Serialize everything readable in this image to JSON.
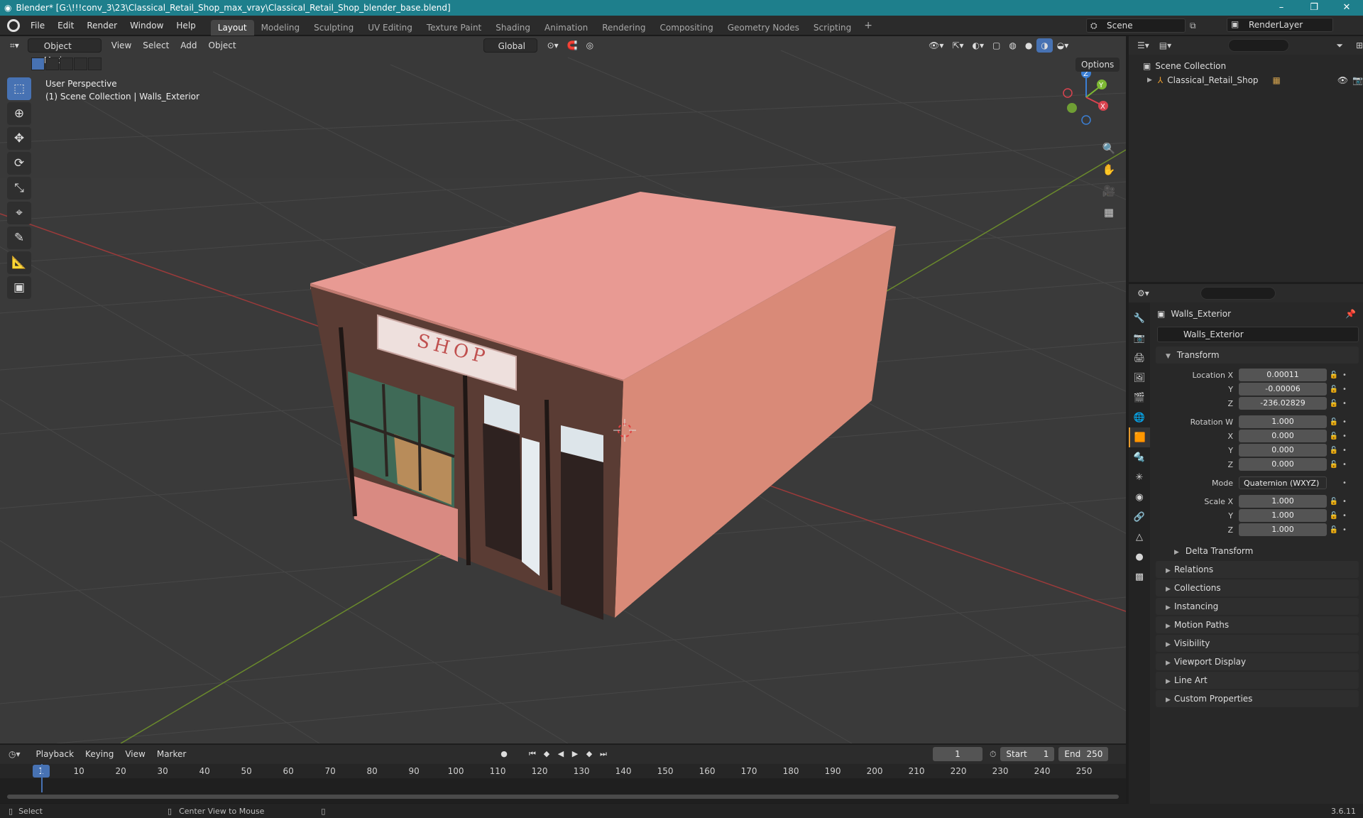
{
  "titlebar": {
    "title": "Blender* [G:\\!!!conv_3\\23\\Classical_Retail_Shop_max_vray\\Classical_Retail_Shop_blender_base.blend]",
    "minimize": "–",
    "maximize": "❐",
    "close": "✕"
  },
  "menu": [
    "File",
    "Edit",
    "Render",
    "Window",
    "Help"
  ],
  "workspaces": [
    "Layout",
    "Modeling",
    "Sculpting",
    "UV Editing",
    "Texture Paint",
    "Shading",
    "Animation",
    "Rendering",
    "Compositing",
    "Geometry Nodes",
    "Scripting"
  ],
  "workspace_add": "+",
  "scene": {
    "name": "Scene",
    "render_layer": "RenderLayer"
  },
  "viewport": {
    "mode": "Object Mode",
    "menus": [
      "View",
      "Select",
      "Add",
      "Object"
    ],
    "orientation": "Global",
    "options_label": "Options",
    "info_line1": "User Perspective",
    "info_line2": "(1) Scene Collection | Walls_Exterior",
    "shop_sign": "SHOP",
    "gizmo": {
      "x": "X",
      "y": "Y",
      "z": "Z"
    }
  },
  "outliner": {
    "root": "Scene Collection",
    "items": [
      {
        "label": "Classical_Retail_Shop"
      }
    ]
  },
  "properties": {
    "object_name": "Walls_Exterior",
    "data_name": "Walls_Exterior",
    "transform_label": "Transform",
    "location": {
      "label": "Location X",
      "x": "0.00011",
      "y": "-0.00006",
      "z": "-236.02829"
    },
    "rotation": {
      "label": "Rotation W",
      "w": "1.000",
      "x": "0.000",
      "y": "0.000",
      "z": "0.000"
    },
    "mode_label": "Mode",
    "mode_value": "Quaternion (WXYZ)",
    "scale": {
      "label": "Scale X",
      "x": "1.000",
      "y": "1.000",
      "z": "1.000"
    },
    "axis_labels": {
      "x": "X",
      "y": "Y",
      "z": "Z"
    },
    "delta_label": "Delta Transform",
    "panels": [
      "Relations",
      "Collections",
      "Instancing",
      "Motion Paths",
      "Visibility",
      "Viewport Display",
      "Line Art",
      "Custom Properties"
    ]
  },
  "timeline": {
    "menus": [
      "Playback",
      "Keying",
      "View",
      "Marker"
    ],
    "current_frame": "1",
    "start_label": "Start",
    "start": "1",
    "end_label": "End",
    "end": "250",
    "ticks": [
      "1",
      "10",
      "20",
      "30",
      "40",
      "50",
      "60",
      "70",
      "80",
      "90",
      "100",
      "110",
      "120",
      "130",
      "140",
      "150",
      "160",
      "170",
      "180",
      "190",
      "200",
      "210",
      "220",
      "230",
      "240",
      "250"
    ]
  },
  "statusbar": {
    "select": "Select",
    "center": "Center View to Mouse",
    "version": "3.6.11"
  },
  "colors": {
    "accent": "#4772b3",
    "title_bar": "#1e7f8c",
    "wall": "#d98c7d",
    "roof": "#e89a93",
    "active_tab": "#e69a2e"
  }
}
